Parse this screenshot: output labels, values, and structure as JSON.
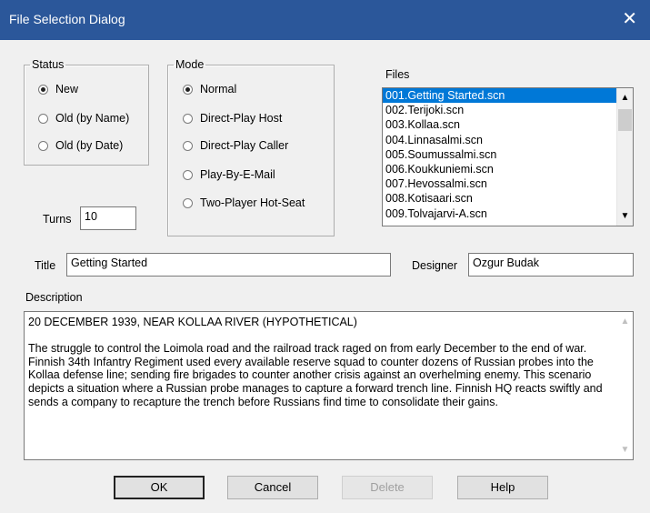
{
  "window": {
    "title": "File Selection Dialog",
    "close_glyph": "✕"
  },
  "status": {
    "legend": "Status",
    "options": [
      {
        "label": "New",
        "selected": true
      },
      {
        "label": "Old (by Name)",
        "selected": false
      },
      {
        "label": "Old (by Date)",
        "selected": false
      }
    ]
  },
  "mode": {
    "legend": "Mode",
    "options": [
      {
        "label": "Normal",
        "selected": true
      },
      {
        "label": "Direct-Play Host",
        "selected": false
      },
      {
        "label": "Direct-Play Caller",
        "selected": false
      },
      {
        "label": "Play-By-E-Mail",
        "selected": false
      },
      {
        "label": "Two-Player Hot-Seat",
        "selected": false
      }
    ]
  },
  "turns": {
    "label": "Turns",
    "value": "10"
  },
  "files": {
    "label": "Files",
    "items": [
      "001.Getting Started.scn",
      "002.Terijoki.scn",
      "003.Kollaa.scn",
      "004.Linnasalmi.scn",
      "005.Soumussalmi.scn",
      "006.Koukkuniemi.scn",
      "007.Hevossalmi.scn",
      "008.Kotisaari.scn",
      "009.Tolvajarvi-A.scn"
    ],
    "selected_index": 0
  },
  "title_field": {
    "label": "Title",
    "value": "Getting Started"
  },
  "designer_field": {
    "label": "Designer",
    "value": "Ozgur Budak"
  },
  "description": {
    "label": "Description",
    "paragraphs": [
      "20 DECEMBER 1939, NEAR KOLLAA RIVER (HYPOTHETICAL)",
      "The struggle to control the Loimola road and the railroad track raged on from early December to the end of war. Finnish 34th Infantry Regiment used every available reserve squad to counter dozens of Russian probes into the Kollaa defense line; sending fire brigades to counter another crisis against an overhelming enemy. This scenario depicts a situation where a Russian probe manages to capture a forward trench line. Finnish HQ reacts swiftly and sends a company to recapture the trench before Russians find time to consolidate their gains."
    ]
  },
  "buttons": {
    "ok": "OK",
    "cancel": "Cancel",
    "delete": "Delete",
    "help": "Help"
  }
}
